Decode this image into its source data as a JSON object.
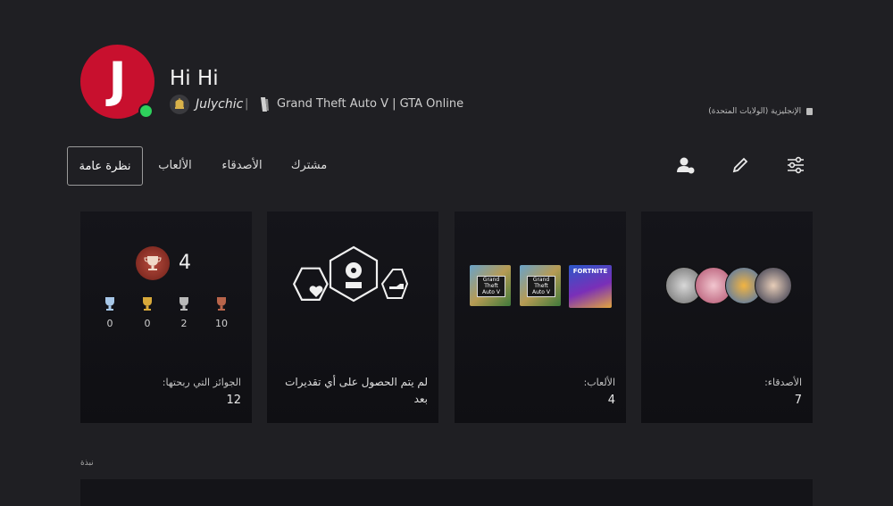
{
  "profile": {
    "avatar_letter": "J",
    "name": "Hi Hi",
    "online_id": "Julychic",
    "separator": "|",
    "now_playing": "Grand Theft Auto V | GTA Online",
    "language_region": "الإنجليزية (الولايات المتحدة)",
    "status_color": "#2ed15c",
    "avatar_color": "#c8102e"
  },
  "tabs": [
    {
      "label": "نظرة عامة",
      "selected": true
    },
    {
      "label": "الألعاب"
    },
    {
      "label": "الأصدقاء"
    },
    {
      "label": "مشترك"
    }
  ],
  "toolbar": {
    "icons": [
      "add-friend-icon",
      "edit-icon",
      "filter-icon"
    ]
  },
  "cards": {
    "trophies": {
      "level": "4",
      "counts": {
        "platinum": "0",
        "gold": "0",
        "silver": "2",
        "bronze": "10"
      },
      "label": "الجوائز التي ربحتها:",
      "value": "12"
    },
    "accolades": {
      "label": "لم يتم الحصول على أي تقديرات بعد"
    },
    "games": {
      "thumbnails": [
        "Grand Theft Auto V",
        "Grand Theft Auto V",
        "FORTNITE"
      ],
      "label": "الألعاب:",
      "value": "4"
    },
    "friends": {
      "label": "الأصدقاء:",
      "value": "7"
    }
  },
  "activity": {
    "label": "نبذة"
  }
}
